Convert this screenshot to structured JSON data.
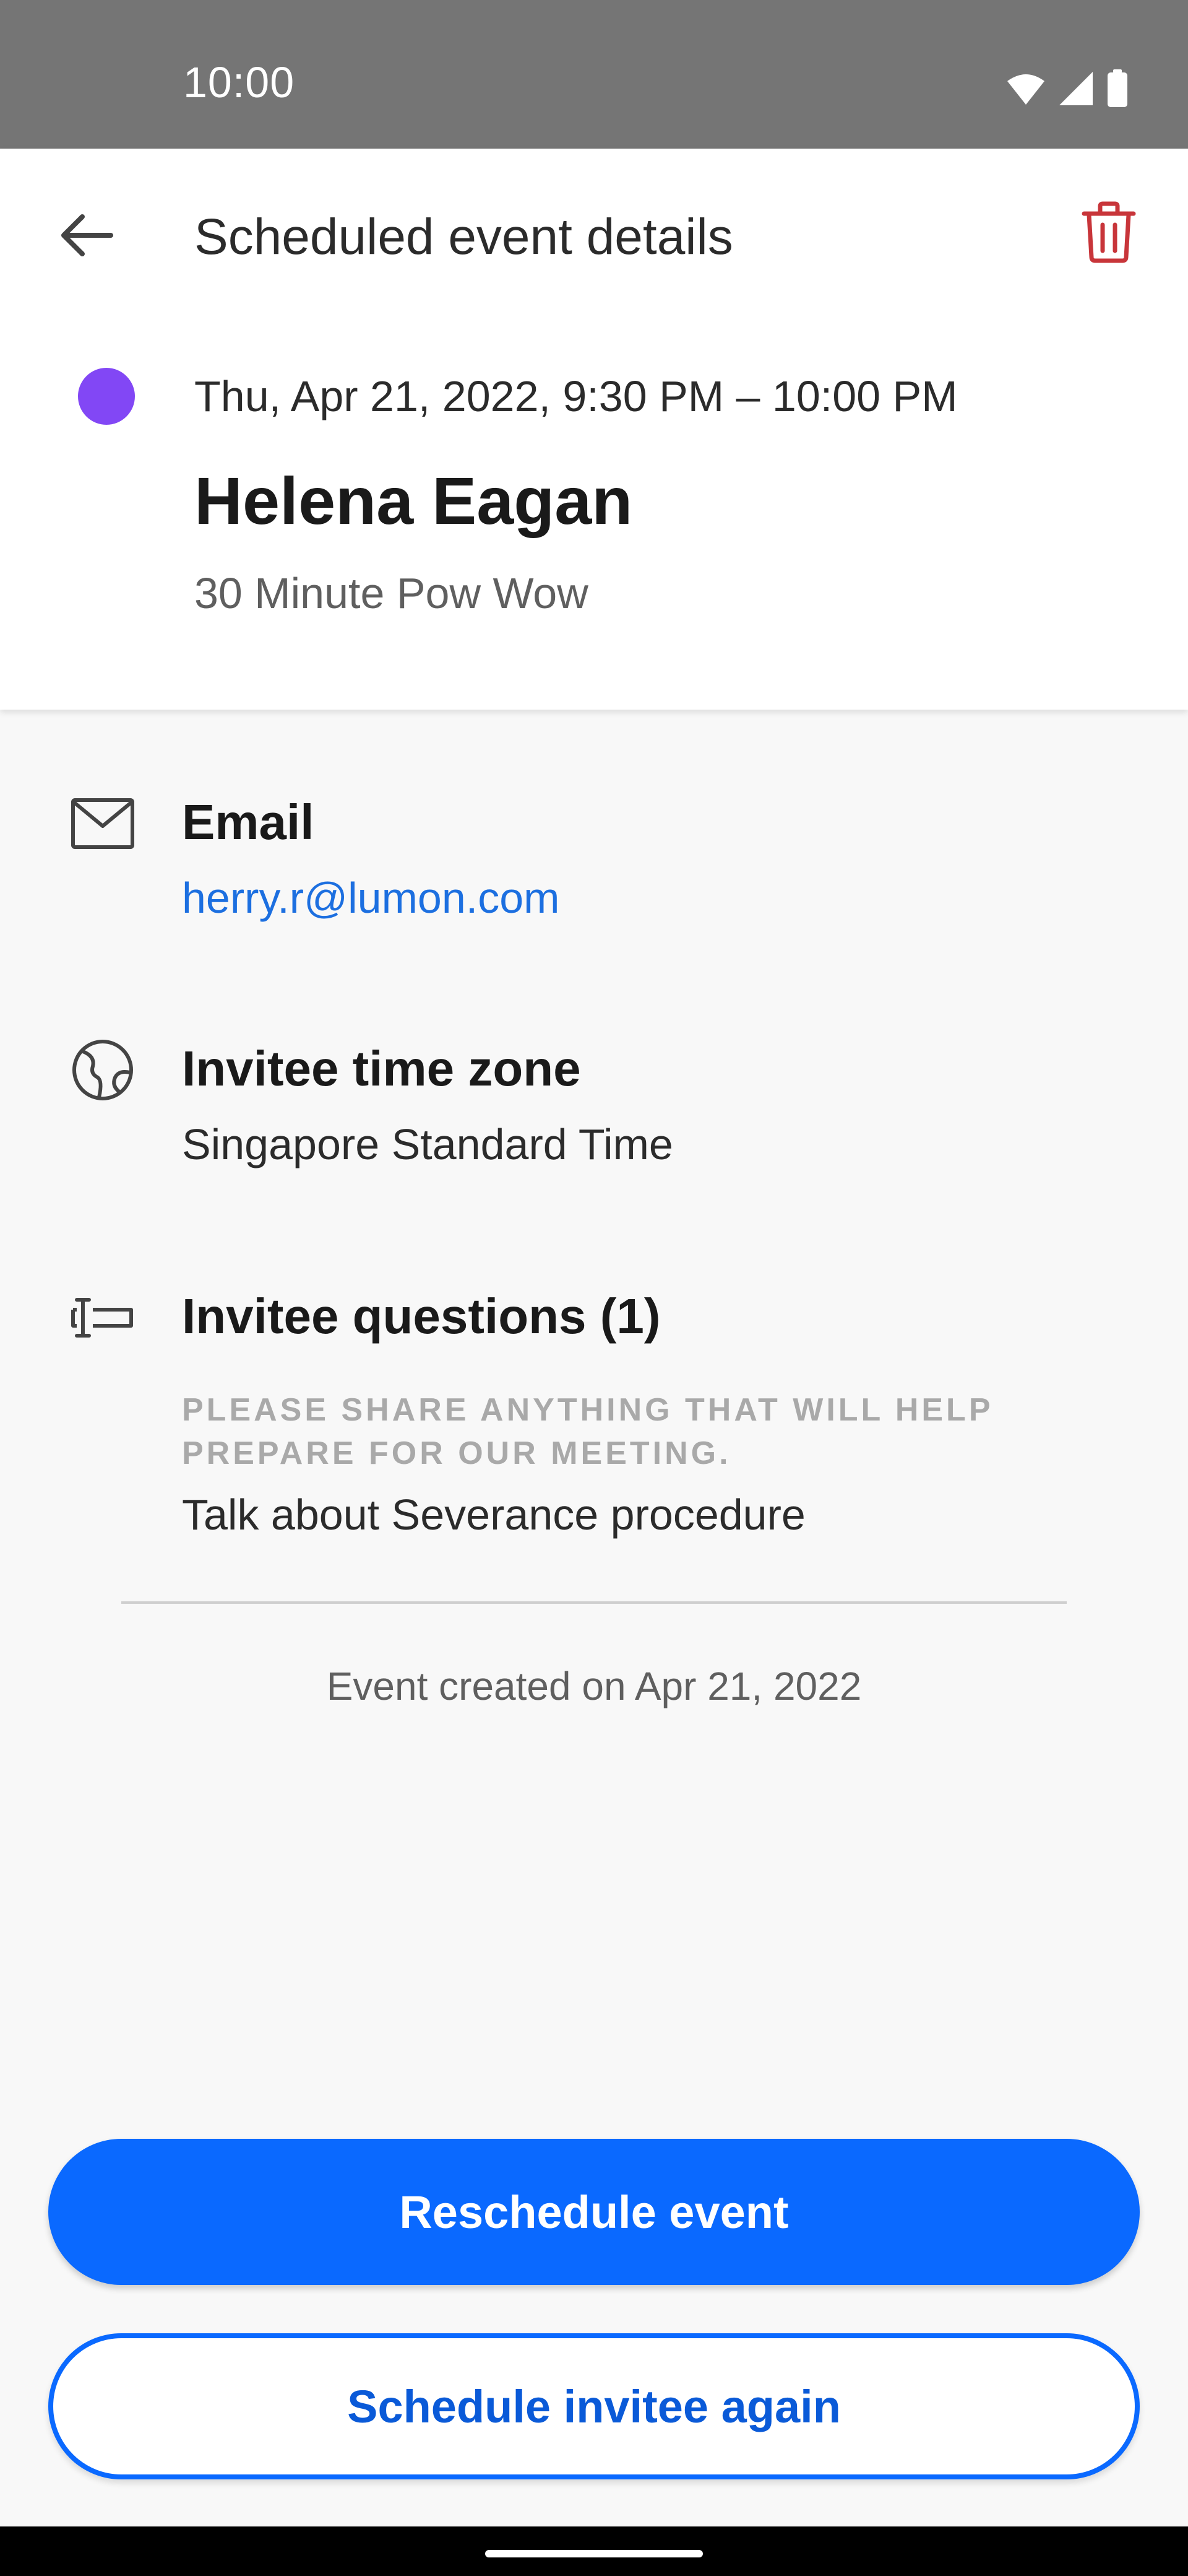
{
  "status_bar": {
    "time": "10:00",
    "icons": [
      "wifi-icon",
      "signal-icon",
      "battery-icon"
    ]
  },
  "header": {
    "title": "Scheduled event details",
    "back_icon": "back-arrow-icon",
    "delete_icon": "trash-icon"
  },
  "event": {
    "datetime": "Thu, Apr 21, 2022, 9:30 PM – 10:00 PM",
    "invitee_name": "Helena Eagan",
    "event_type": "30 Minute Pow Wow",
    "dot_color": "#8247f5"
  },
  "details": {
    "email": {
      "label": "Email",
      "value": "herry.r@lumon.com",
      "icon": "mail-icon"
    },
    "timezone": {
      "label": "Invitee time zone",
      "value": "Singapore Standard Time",
      "icon": "globe-icon"
    },
    "questions": {
      "label": "Invitee questions (1)",
      "icon": "text-field-icon",
      "question": "PLEASE SHARE ANYTHING THAT WILL HELP PREPARE FOR OUR MEETING.",
      "answer": "Talk about Severance procedure"
    }
  },
  "created_on": "Event created on Apr 21, 2022",
  "actions": {
    "reschedule": "Reschedule event",
    "schedule_again": "Schedule invitee again"
  },
  "colors": {
    "primary": "#0a69ff",
    "link": "#1c6fe0",
    "delete": "#c8353a",
    "status_bar": "#757575"
  }
}
